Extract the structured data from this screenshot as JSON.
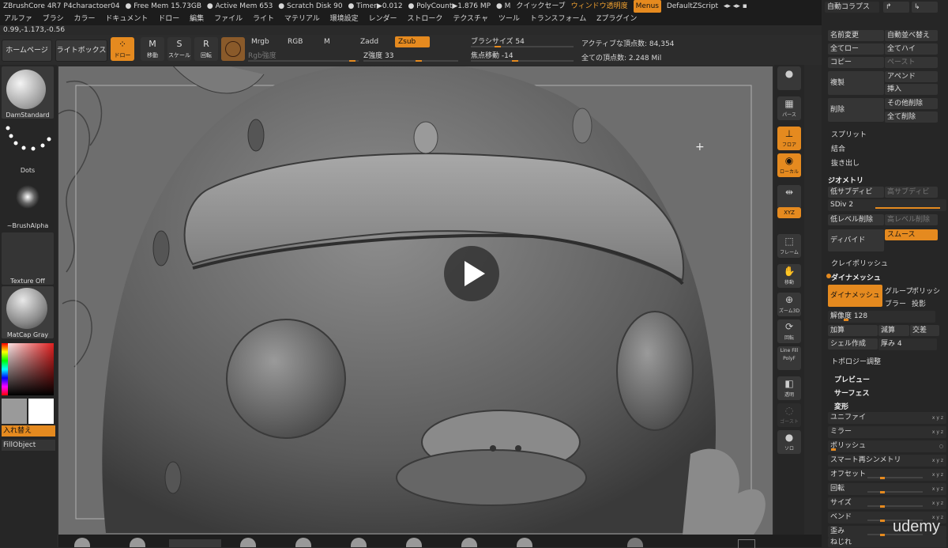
{
  "titlebar": {
    "app": "ZBrushCore 4R7 P4charactoer04",
    "free_mem": "● Free Mem 15.73GB",
    "active_mem": "● Active Mem 653",
    "scratch": "● Scratch Disk 90",
    "timer": "● Timer▶0.012",
    "polycount": "● PolyCount▶1.876 MP",
    "m": "● M",
    "quicksave": "クイックセーブ",
    "transparency": "ウィンドウ透明度",
    "menus": "Menus",
    "script": "DefaultZScript"
  },
  "menubar": [
    "アルファ",
    "ブラシ",
    "カラー",
    "ドキュメント",
    "ドロー",
    "編集",
    "ファイル",
    "ライト",
    "マテリアル",
    "環境設定",
    "レンダー",
    "ストローク",
    "テクスチャ",
    "ツール",
    "トランスフォーム",
    "Zプラグイン"
  ],
  "coords": "0.99,-1.173,-0.56",
  "toolbar": {
    "home": "ホームページ",
    "lightbox": "ライトボックス",
    "draw": "ドロー",
    "move": "移動",
    "scale": "スケール",
    "rotate": "回転",
    "mrgb": "Mrgb",
    "rgb": "RGB",
    "m": "M",
    "zadd": "Zadd",
    "zsub": "Zsub",
    "rgb_intensity": "Rgb強度",
    "z_intensity": "Z強度 33",
    "z_intensity_value": 33,
    "brush_size": "ブラシサイズ 54",
    "brush_size_value": 54,
    "focal_shift": "焦点移動 -14",
    "focal_shift_value": -14,
    "active_points": "アクティブな頂点数: 84,354",
    "total_points": "全ての頂点数: 2.248 Mil"
  },
  "left": {
    "brush": "DamStandard",
    "stroke": "Dots",
    "alpha": "~BrushAlpha",
    "texture": "Texture Off",
    "material": "MatCap Gray",
    "swap": "入れ替え",
    "fill": "FillObject"
  },
  "iconstrip": {
    "persp": "パース",
    "floor": "フロア",
    "local": "ローカル",
    "transp": "透明",
    "frame": "フレーム",
    "move": "移動",
    "zoom": "ズーム3D",
    "rotate": "回転",
    "linefill": "Line Fill",
    "polyf": "PolyF",
    "transparent": "透明",
    "ghost": "ゴースト",
    "solo": "ソロ",
    "xyz": "XYZ"
  },
  "right": {
    "autocollapse": "自動コラプス",
    "rename": "名前変更",
    "autosort": "自動並べ替え",
    "all_low": "全てロー",
    "all_high": "全てハイ",
    "copy": "コピー",
    "paste": "ペースト",
    "duplicate": "複製",
    "append": "アペンド",
    "insert": "挿入",
    "delete": "削除",
    "delete_other": "その他削除",
    "delete_all": "全て削除",
    "split": "スプリット",
    "merge": "結合",
    "extract": "抜き出し",
    "geometry": "ジオメトリ",
    "lower_subdiv": "低サブディビ",
    "higher_subdiv": "高サブディビ",
    "sdiv": "SDiv 2",
    "del_lower": "低レベル削除",
    "del_higher": "高レベル削除",
    "divide": "ディバイド",
    "smooth": "スムース",
    "claypolish": "クレイポリッシュ",
    "dynamesh_head": "ダイナメッシュ",
    "dynamesh_btn": "ダイナメッシュ",
    "groups": "グループ",
    "polish": "ポリッシ",
    "blur": "ブラー",
    "project": "投影",
    "resolution": "解像度 128",
    "add": "加算",
    "sub": "減算",
    "intersect": "交差",
    "shell": "シェル作成",
    "thickness": "厚み 4",
    "topology": "トポロジー調整",
    "preview": "プレビュー",
    "surface": "サーフェス",
    "deform": "変形",
    "deform_items": [
      "ユニファイ",
      "ミラー",
      "ポリッシュ",
      "スマート再シンメトリ",
      "オフセット",
      "回転",
      "サイズ",
      "ベンド",
      "歪み",
      "ねじれ"
    ]
  },
  "watermark": "udemy",
  "colors": {
    "accent": "#e58a1f",
    "panel": "#262626",
    "viewport": "#6c6c6c"
  }
}
